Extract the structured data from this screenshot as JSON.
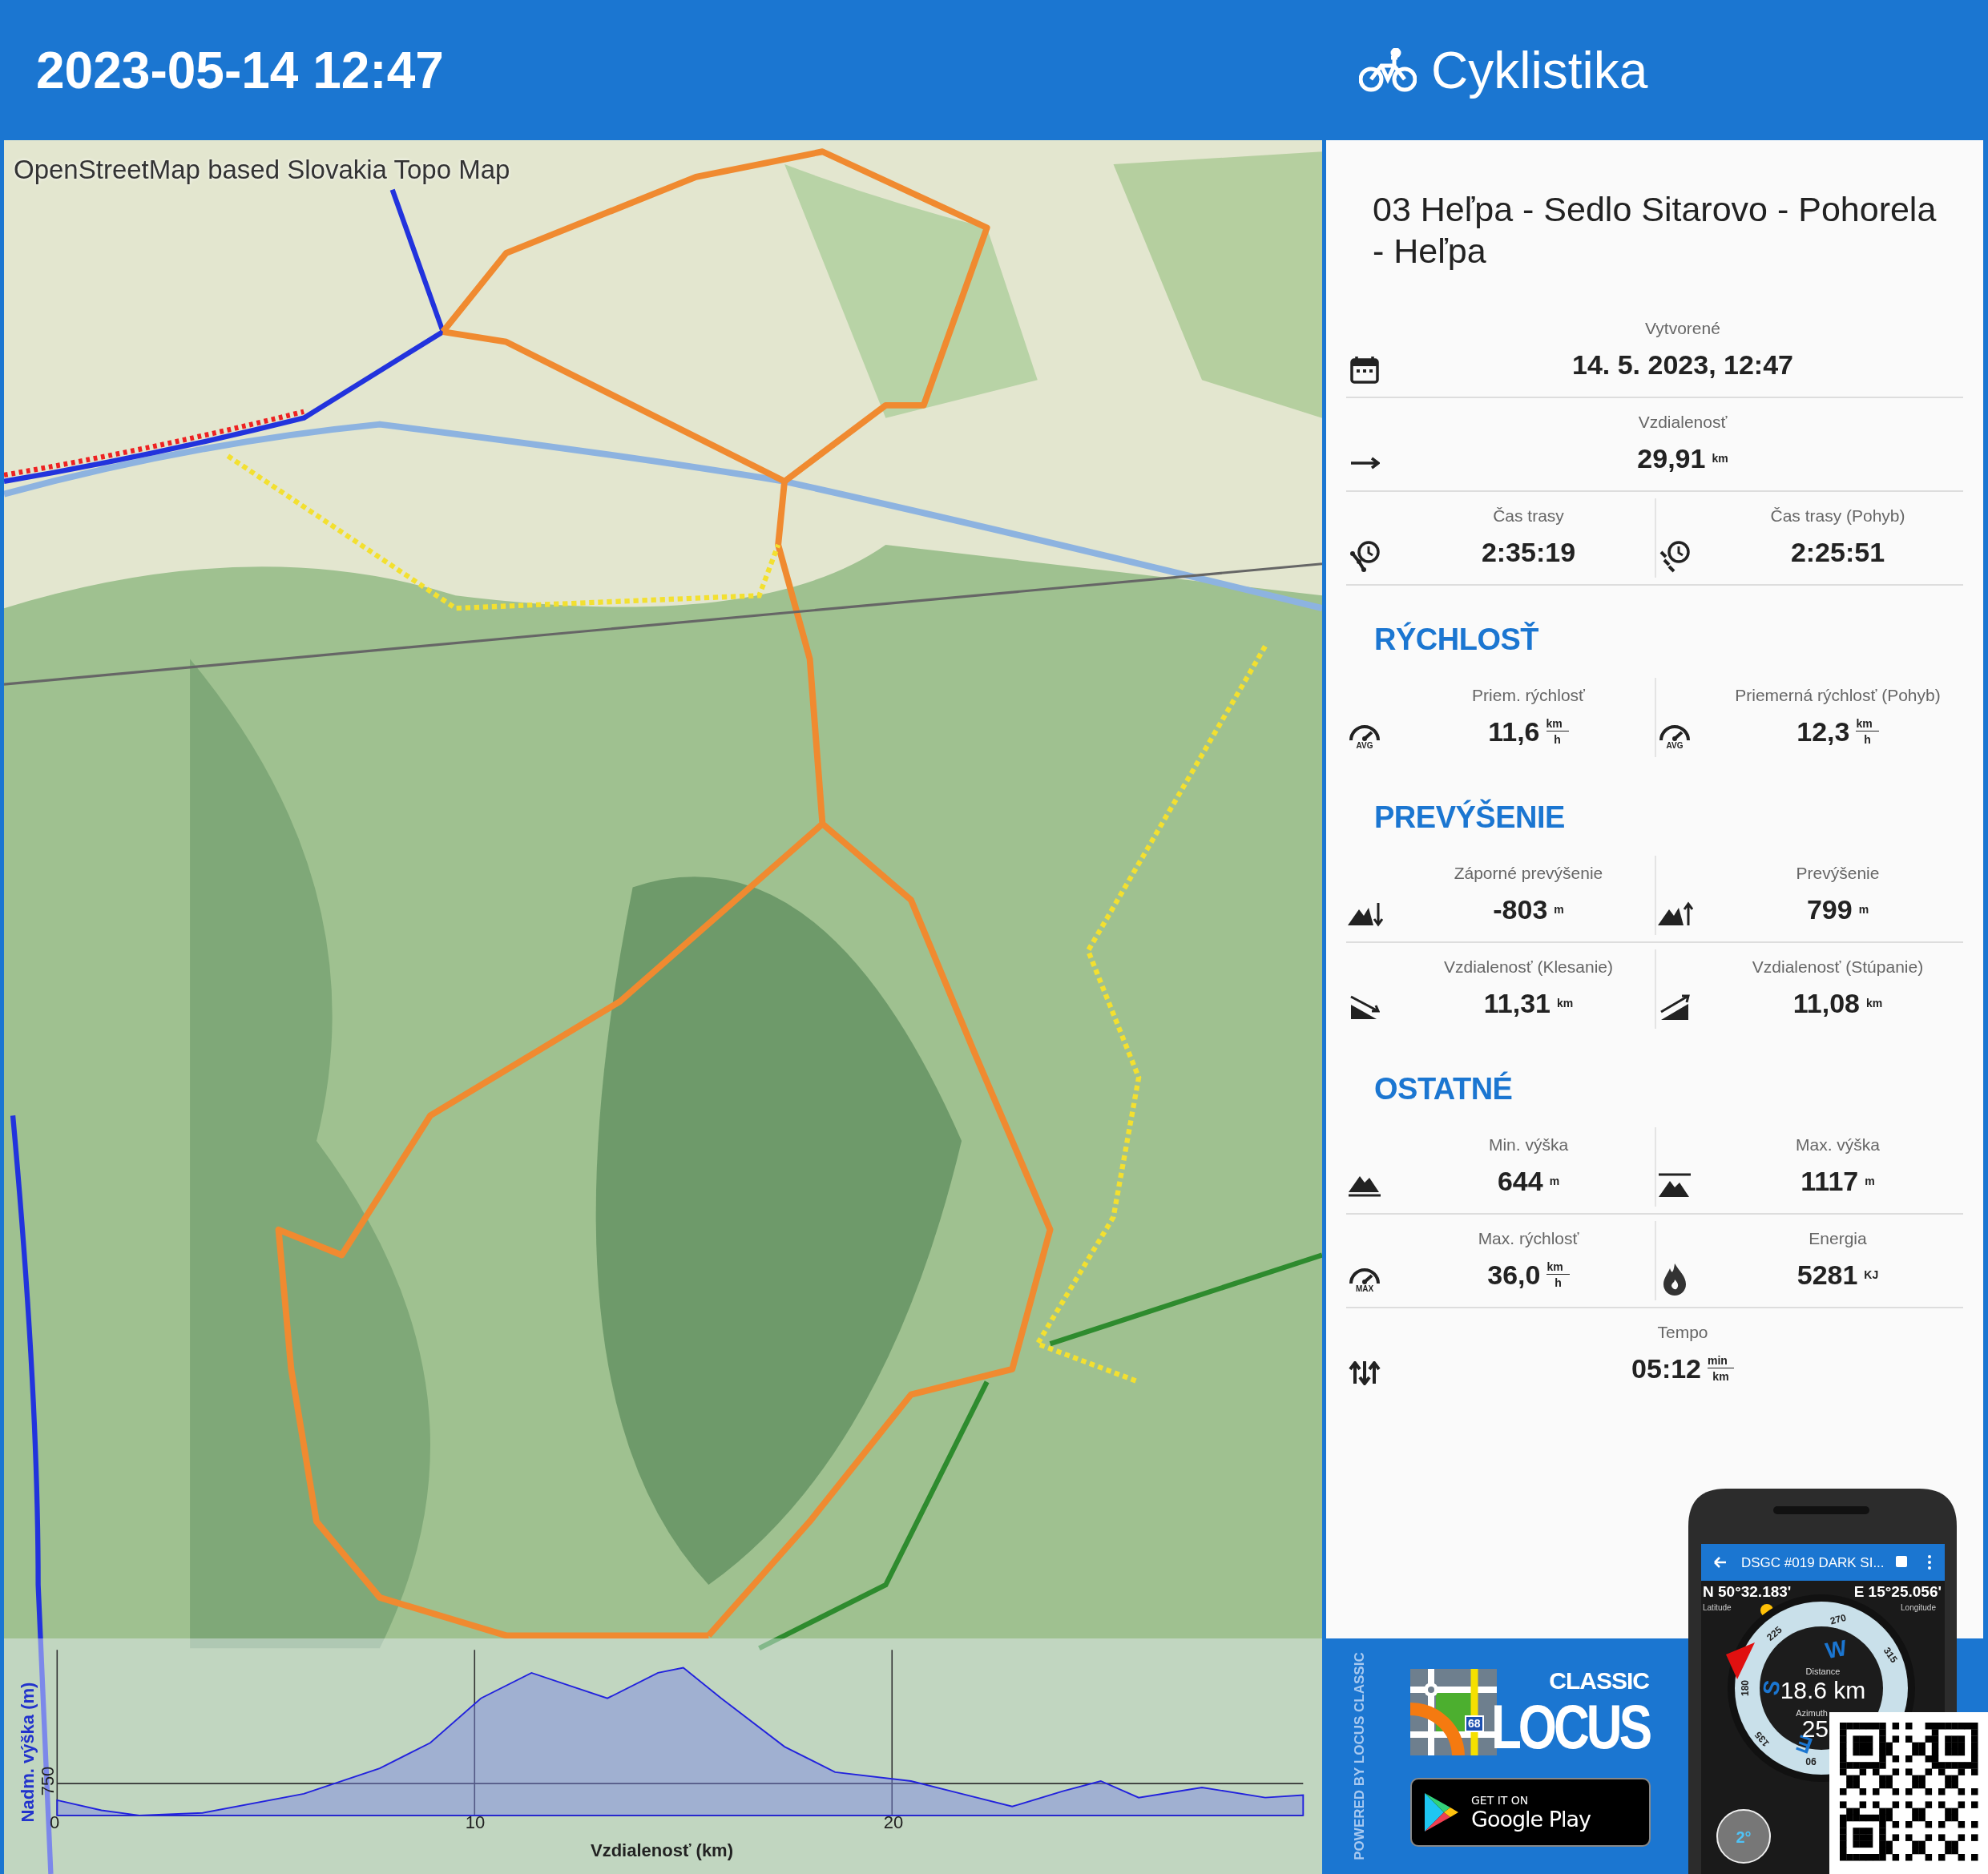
{
  "header": {
    "datetime": "2023-05-14 12:47",
    "activity": "Cyklistika"
  },
  "map": {
    "attribution": "OpenStreetMap based Slovakia Topo Map",
    "elevation": {
      "ylabel": "Nadm. výška (m)",
      "ytick": "750",
      "xticks": [
        "0",
        "10",
        "20"
      ],
      "xlabel": "Vzdialenosť (km)"
    }
  },
  "track": {
    "title": "03 Heľpa - Sedlo Sitarovo - Pohorela - Heľpa",
    "sections": [
      {
        "rows": [
          {
            "cells": [
              {
                "kind": "calendar",
                "label": "Vytvorené",
                "value": "14. 5. 2023, 12:47"
              }
            ]
          },
          {
            "cells": [
              {
                "kind": "arrow",
                "label": "Vzdialenosť",
                "value": "29,91",
                "unit": "km"
              }
            ]
          },
          {
            "cells": [
              {
                "kind": "route-time",
                "label": "Čas trasy",
                "value": "2:35:19"
              },
              {
                "kind": "moving-time",
                "label": "Čas trasy (Pohyb)",
                "value": "2:25:51"
              }
            ]
          }
        ]
      },
      {
        "heading": "RÝCHLOSŤ",
        "rows": [
          {
            "cells": [
              {
                "kind": "speed",
                "icon_text": "AVG",
                "label": "Priem. rýchlosť",
                "value": "11,6",
                "unit": "km",
                "unit_den": "h"
              },
              {
                "kind": "speed",
                "icon_text": "AVG",
                "label": "Priemerná rýchlosť (Pohyb)",
                "value": "12,3",
                "unit": "km",
                "unit_den": "h"
              }
            ]
          }
        ]
      },
      {
        "heading": "PREVÝŠENIE",
        "rows": [
          {
            "cells": [
              {
                "kind": "descent",
                "label": "Záporné prevýšenie",
                "value": "-803",
                "unit": "m"
              },
              {
                "kind": "ascent",
                "label": "Prevýšenie",
                "value": "799",
                "unit": "m"
              }
            ]
          },
          {
            "cells": [
              {
                "kind": "slope-down",
                "label": "Vzdialenosť (Klesanie)",
                "value": "11,31",
                "unit": "km"
              },
              {
                "kind": "slope-up",
                "label": "Vzdialenosť (Stúpanie)",
                "value": "11,08",
                "unit": "km"
              }
            ]
          }
        ]
      },
      {
        "heading": "OSTATNÉ",
        "rows": [
          {
            "cells": [
              {
                "kind": "min-alt",
                "label": "Min. výška",
                "value": "644",
                "unit": "m"
              },
              {
                "kind": "max-alt",
                "label": "Max. výška",
                "value": "1117",
                "unit": "m"
              }
            ]
          },
          {
            "cells": [
              {
                "kind": "speed",
                "icon_text": "MAX",
                "label": "Max. rýchlosť",
                "value": "36,0",
                "unit": "km",
                "unit_den": "h"
              },
              {
                "kind": "flame",
                "label": "Energia",
                "value": "5281",
                "unit": "KJ"
              }
            ]
          },
          {
            "cells": [
              {
                "kind": "tempo",
                "label": "Tempo",
                "value": "05:12",
                "unit": "min",
                "unit_den": "km"
              }
            ]
          }
        ]
      }
    ]
  },
  "promo": {
    "powered_by": "POWERED BY LOCUS CLASSIC",
    "logo_badge": "68",
    "logo_small": "CLASSIC",
    "logo_big": "LOCUS",
    "store_top": "GET IT ON",
    "store_name": "Google Play"
  },
  "phone": {
    "title": "DSGC #019 DARK SI...",
    "lat": "N 50°32.183'",
    "lat_label": "Latitude",
    "lon": "E 15°25.056'",
    "lon_label": "Longitude",
    "compass_labels": [
      "270",
      "225",
      "315",
      "180",
      "135",
      "90",
      "W",
      "S",
      "E"
    ],
    "distance_label": "Distance",
    "distance": "18.6 km",
    "azimuth_label": "Azimuth",
    "azimuth": "25",
    "tilt": "2°"
  }
}
